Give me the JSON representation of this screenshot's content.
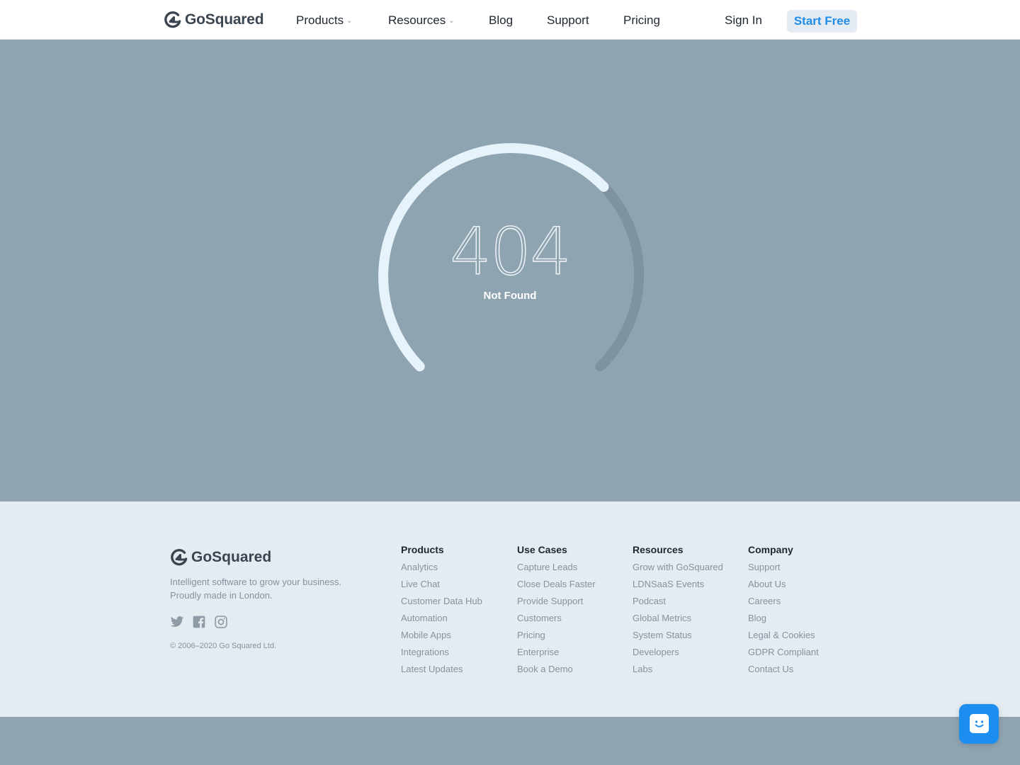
{
  "header": {
    "brand": "GoSquared",
    "nav": {
      "products": "Products",
      "resources": "Resources",
      "blog": "Blog",
      "support": "Support",
      "pricing": "Pricing"
    },
    "sign_in": "Sign In",
    "start_free": "Start Free"
  },
  "hero": {
    "code": "404",
    "message": "Not Found"
  },
  "footer": {
    "brand": "GoSquared",
    "tagline_line1": "Intelligent software to grow your business.",
    "tagline_line2": "Proudly made in London.",
    "social_icons": [
      "twitter-icon",
      "facebook-icon",
      "instagram-icon"
    ],
    "copyright": "© 2006–2020 Go Squared Ltd.",
    "columns": [
      {
        "title": "Products",
        "links": [
          "Analytics",
          "Live Chat",
          "Customer Data Hub",
          "Automation",
          "Mobile Apps",
          "Integrations",
          "Latest Updates"
        ]
      },
      {
        "title": "Use Cases",
        "links": [
          "Capture Leads",
          "Close Deals Faster",
          "Provide Support",
          "Customers",
          "Pricing",
          "Enterprise",
          "Book a Demo"
        ]
      },
      {
        "title": "Resources",
        "links": [
          "Grow with GoSquared",
          "LDNSaaS Events",
          "Podcast",
          "Global Metrics",
          "System Status",
          "Developers",
          "Labs"
        ]
      },
      {
        "title": "Company",
        "links": [
          "Support",
          "About Us",
          "Careers",
          "Blog",
          "Legal & Cookies",
          "GDPR Compliant",
          "Contact Us"
        ]
      }
    ]
  },
  "colors": {
    "hero_bg": "#8fa4b1",
    "footer_bg": "#e4ebf1",
    "accent": "#1f8ceb",
    "gauge_active": "#e6f3fb",
    "gauge_track": "#7f939f"
  }
}
